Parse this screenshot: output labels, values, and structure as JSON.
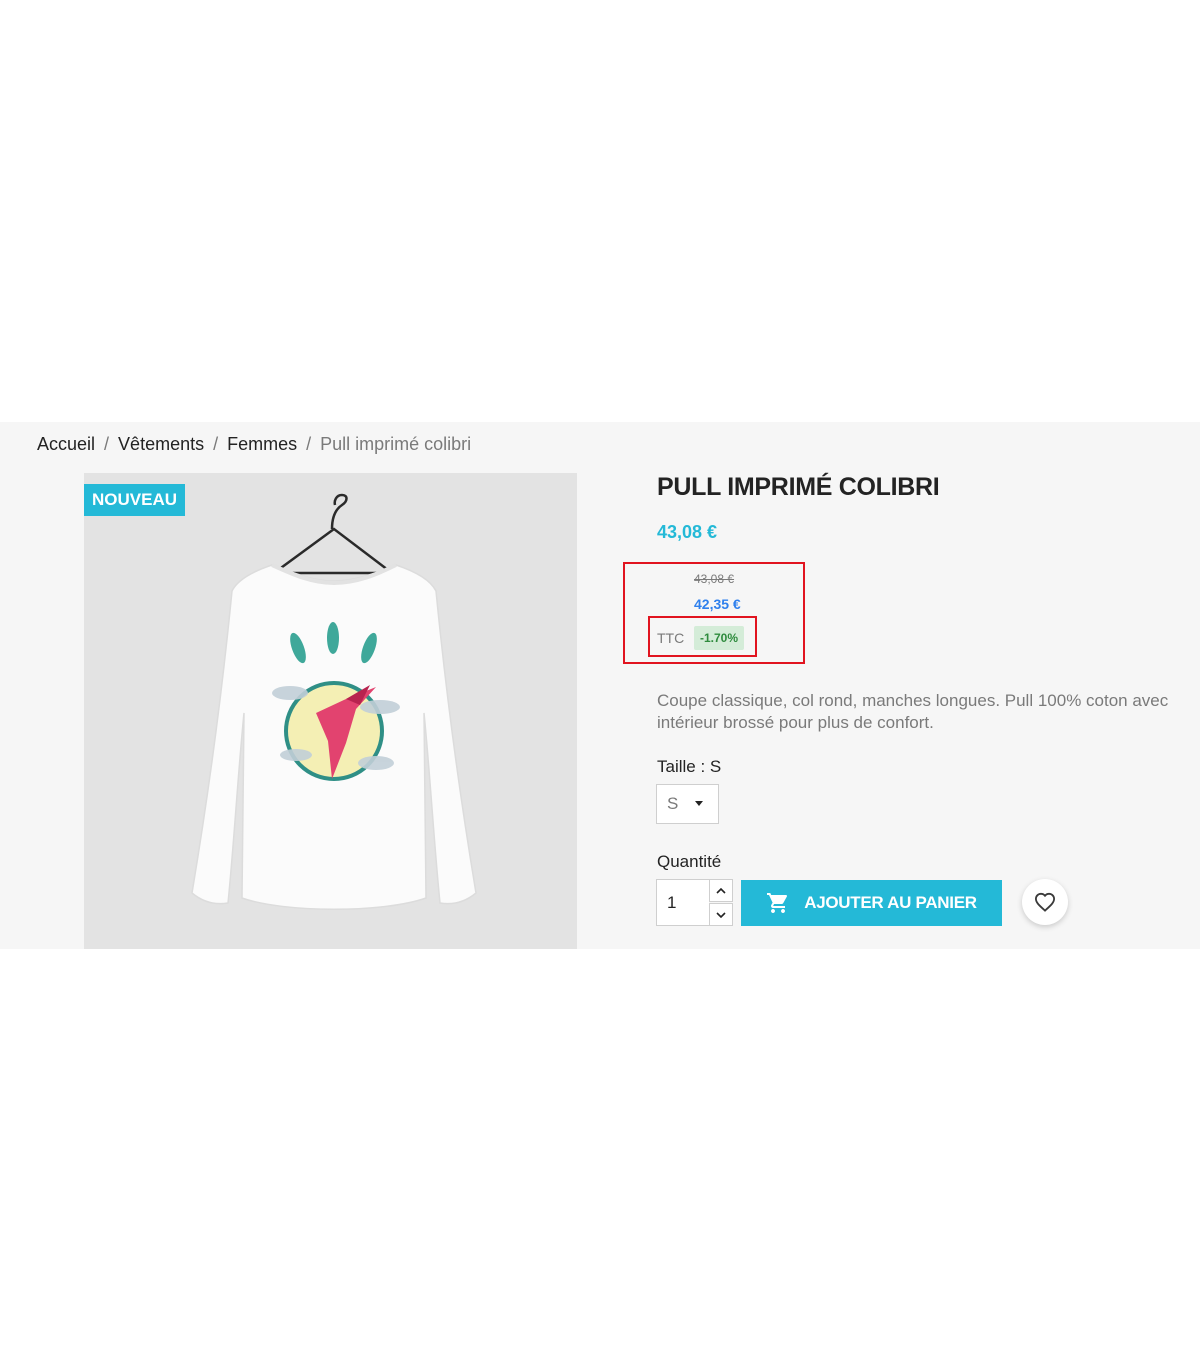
{
  "breadcrumb": {
    "items": [
      "Accueil",
      "Vêtements",
      "Femmes"
    ],
    "current": "Pull imprimé colibri",
    "separator": "/"
  },
  "product": {
    "badge": "NOUVEAU",
    "title": "PULL IMPRIMÉ COLIBRI",
    "price": "43,08 €",
    "old_price": "43,08 €",
    "discounted_price": "42,35 €",
    "tax_label": "TTC",
    "discount": "-1.70%",
    "description": "Coupe classique, col rond, manches longues. Pull 100% coton avec intérieur brossé pour plus de confort.",
    "size_label": "Taille : S",
    "size_selected": "S",
    "quantity_label": "Quantité",
    "quantity_value": "1",
    "add_to_cart_label": "AJOUTER AU PANIER"
  },
  "icons": {
    "cart": "shopping-cart-icon",
    "wishlist": "heart-icon",
    "caret": "caret-down-icon",
    "qty_up": "chevron-up-icon",
    "qty_down": "chevron-down-icon"
  },
  "colors": {
    "accent": "#24b9d7",
    "discount_bg": "#d4ecd8",
    "discount_text": "#2e8b3d",
    "highlight": "#e1141f"
  }
}
